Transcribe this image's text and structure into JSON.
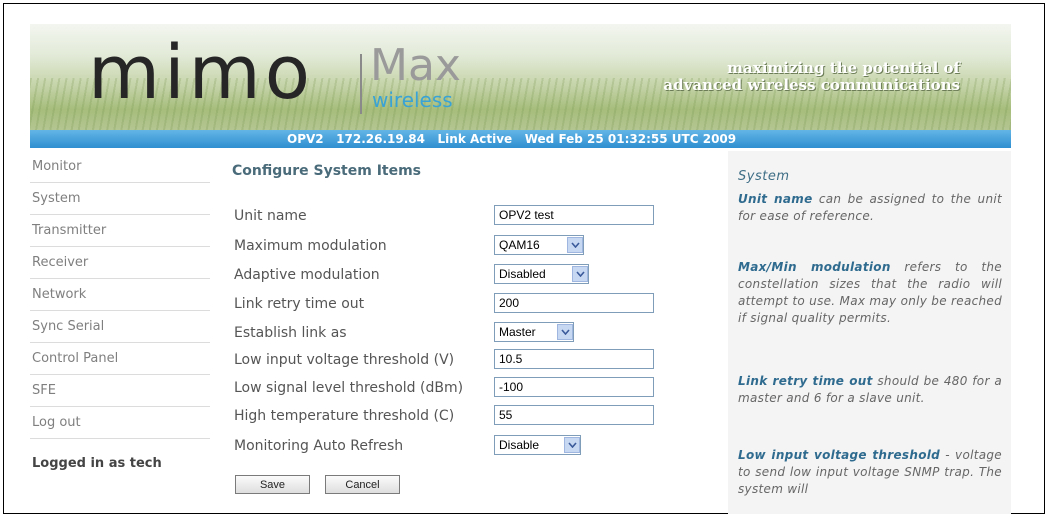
{
  "banner": {
    "logo_mimo": "mimo",
    "logo_max": "Max",
    "logo_wireless": "wireless",
    "tagline_line1": "maximizing the potential of",
    "tagline_line2": "advanced wireless communications",
    "status": "OPV2   172.26.19.84   Link Active   Wed Feb 25 01:32:55 UTC 2009"
  },
  "sidebar": {
    "items": [
      "Monitor",
      "System",
      "Transmitter",
      "Receiver",
      "Network",
      "Sync Serial",
      "Control Panel",
      "SFE",
      "Log out"
    ],
    "logged_in": "Logged in as tech"
  },
  "form": {
    "title": "Configure System Items",
    "unit_name": {
      "label": "Unit name",
      "value": "OPV2 test"
    },
    "max_modulation": {
      "label": "Maximum modulation",
      "value": "QAM16"
    },
    "adaptive_modulation": {
      "label": "Adaptive modulation",
      "value": "Disabled"
    },
    "link_retry": {
      "label": "Link retry time out",
      "value": "200"
    },
    "establish_link": {
      "label": "Establish link as",
      "value": "Master"
    },
    "low_voltage": {
      "label": "Low input voltage threshold (V)",
      "value": "10.5"
    },
    "low_signal": {
      "label": "Low signal level threshold (dBm)",
      "value": "-100"
    },
    "high_temp": {
      "label": "High temperature threshold (C)",
      "value": "55"
    },
    "auto_refresh": {
      "label": "Monitoring Auto Refresh",
      "value": "Disable"
    },
    "save_label": "Save",
    "cancel_label": "Cancel"
  },
  "help": {
    "title": "System",
    "p1_bold": "Unit name",
    "p1_text": " can be assigned to the unit for ease of reference.",
    "p2_bold": "Max/Min modulation",
    "p2_text": " refers to the constellation sizes that the radio will attempt to use. Max may only be reached if signal quality permits.",
    "p3_bold": "Link retry time out",
    "p3_text": " should be 480 for a master and 6 for a slave unit.",
    "p4_bold": "Low input voltage threshold",
    "p4_text": " - voltage to send low input voltage SNMP trap. The system will"
  },
  "colors": {
    "accent_blue": "#2f8fd0",
    "link_blue": "#2f6b8f",
    "border": "#7f9db9"
  }
}
